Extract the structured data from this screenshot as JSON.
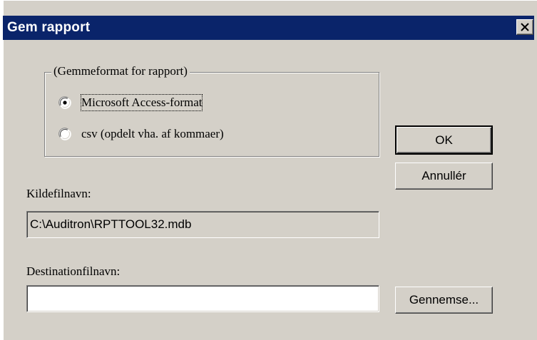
{
  "window": {
    "title": "Gem rapport",
    "close_icon": "close-icon"
  },
  "format_group": {
    "legend": "(Gemmeformat for rapport)",
    "options": [
      {
        "label": "Microsoft Access-format",
        "selected": true
      },
      {
        "label": "csv (opdelt vha. af kommaer)",
        "selected": false
      }
    ]
  },
  "buttons": {
    "ok": "OK",
    "cancel": "Annullér",
    "browse": "Gennemse..."
  },
  "source": {
    "label": "Kildefilnavn:",
    "value": "C:\\Auditron\\RPTTOOL32.mdb"
  },
  "destination": {
    "label": "Destinationfilnavn:",
    "value": ""
  },
  "colors": {
    "titlebar": "#0a246a",
    "face": "#d4d0c8"
  }
}
